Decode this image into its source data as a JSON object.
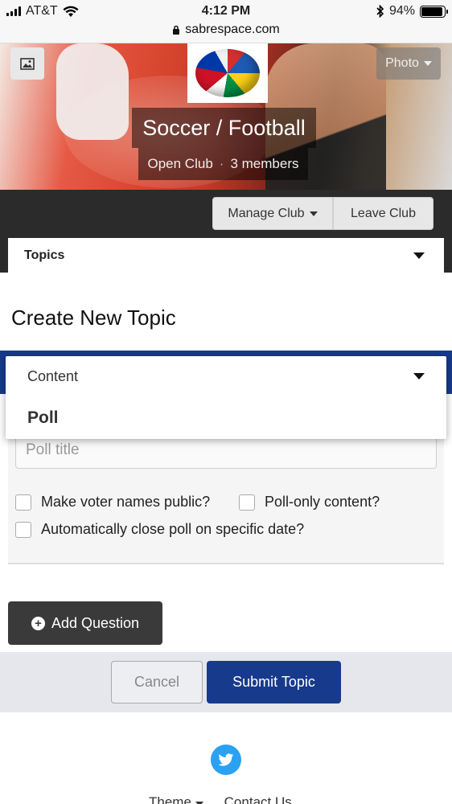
{
  "status_bar": {
    "carrier": "AT&T",
    "time": "4:12 PM",
    "battery": "94%",
    "battery_level": 0.94
  },
  "browser": {
    "url": "sabrespace.com"
  },
  "club": {
    "photo_button": "Photo",
    "name": "Soccer / Football",
    "type": "Open Club",
    "members": "3 members"
  },
  "actions": {
    "manage": "Manage Club",
    "leave": "Leave Club"
  },
  "topics_tab": "Topics",
  "page_title": "Create New Topic",
  "type_dropdown": {
    "header": "Content",
    "selected": "Poll"
  },
  "poll": {
    "title_placeholder": "Poll title",
    "option_public": "Make voter names public?",
    "option_poll_only": "Poll-only content?",
    "option_auto_close": "Automatically close poll on specific date?"
  },
  "add_question": "Add Question",
  "buttons": {
    "cancel": "Cancel",
    "submit": "Submit Topic"
  },
  "footer": {
    "theme": "Theme",
    "contact": "Contact Us"
  },
  "colors": {
    "primary": "#173a8c",
    "dark": "#2b2b2b",
    "twitter": "#2aa1f2"
  }
}
